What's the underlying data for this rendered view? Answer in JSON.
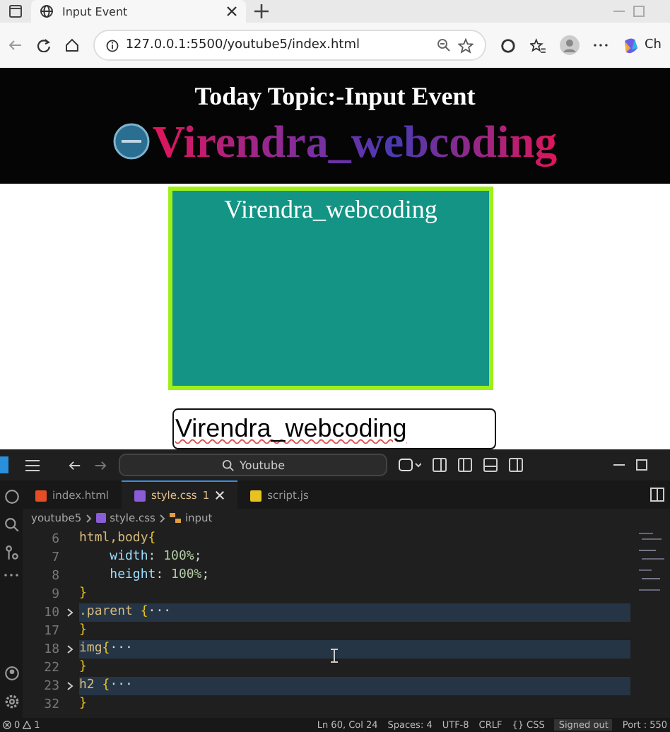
{
  "browser": {
    "tab_title": "Input Event",
    "url": "127.0.0.1:5500/youtube5/index.html",
    "copilot_label": "Ch"
  },
  "page": {
    "heading": "Today Topic:-Input Event",
    "brand": "Virendra_webcoding",
    "box_text": "Virendra_webcoding",
    "input_value": "Virendra_webcoding"
  },
  "editor": {
    "search": "Youtube",
    "tabs": [
      {
        "label": "index.html",
        "kind": "html",
        "selected": false
      },
      {
        "label": "style.css",
        "kind": "css",
        "selected": true,
        "badge": "1"
      },
      {
        "label": "script.js",
        "kind": "js",
        "selected": false
      }
    ],
    "breadcrumb": [
      "youtube5",
      "style.css",
      "input"
    ],
    "lines": [
      {
        "number": "6",
        "folded": false,
        "tokens": [
          {
            "text": "html,body",
            "kind": "selector"
          },
          {
            "text": "{",
            "kind": "brace"
          }
        ]
      },
      {
        "number": "7",
        "folded": false,
        "tokens": [
          {
            "text": "    width",
            "kind": "prop"
          },
          {
            "text": ": ",
            "kind": "plain"
          },
          {
            "text": "100%",
            "kind": "value"
          },
          {
            "text": ";",
            "kind": "plain"
          }
        ]
      },
      {
        "number": "8",
        "folded": false,
        "tokens": [
          {
            "text": "    height",
            "kind": "prop"
          },
          {
            "text": ": ",
            "kind": "plain"
          },
          {
            "text": "100%",
            "kind": "value"
          },
          {
            "text": ";",
            "kind": "plain"
          }
        ]
      },
      {
        "number": "9",
        "folded": false,
        "tokens": [
          {
            "text": "}",
            "kind": "brace"
          }
        ]
      },
      {
        "number": "10",
        "folded": true,
        "tokens": [
          {
            "text": ".parent ",
            "kind": "selector"
          },
          {
            "text": "{",
            "kind": "brace"
          },
          {
            "text": "···",
            "kind": "plain"
          }
        ]
      },
      {
        "number": "17",
        "folded": false,
        "tokens": [
          {
            "text": "}",
            "kind": "brace"
          }
        ]
      },
      {
        "number": "18",
        "folded": true,
        "tokens": [
          {
            "text": "img",
            "kind": "selector"
          },
          {
            "text": "{",
            "kind": "brace"
          },
          {
            "text": "···",
            "kind": "plain"
          }
        ]
      },
      {
        "number": "22",
        "folded": false,
        "tokens": [
          {
            "text": "}",
            "kind": "brace"
          }
        ]
      },
      {
        "number": "23",
        "folded": true,
        "tokens": [
          {
            "text": "h2 ",
            "kind": "selector"
          },
          {
            "text": "{",
            "kind": "brace"
          },
          {
            "text": "···",
            "kind": "plain"
          }
        ]
      },
      {
        "number": "32",
        "folded": false,
        "tokens": [
          {
            "text": "}",
            "kind": "brace"
          }
        ]
      }
    ],
    "status": {
      "errors": "0",
      "warnings": "1",
      "items": [
        "Ln 60, Col 24",
        "Spaces: 4",
        "UTF-8",
        "CRLF",
        "{} CSS"
      ],
      "account": "Signed out",
      "port": "Port : 550"
    }
  }
}
